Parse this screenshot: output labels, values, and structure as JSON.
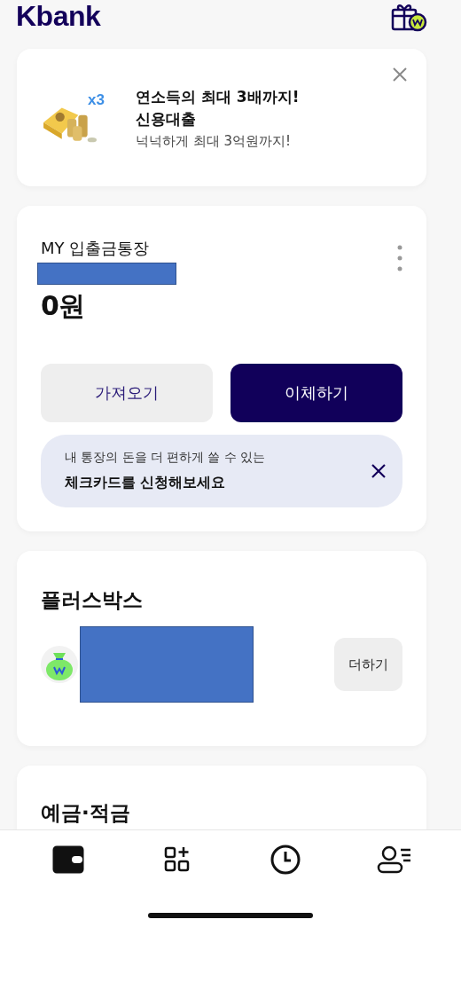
{
  "header": {
    "logo": "Kbank"
  },
  "promo": {
    "badge": "x3",
    "title_lines": [
      "연소득의 최대 3배까지!",
      "신용대출"
    ],
    "subtitle": "넉넉하게 최대 3억원까지!"
  },
  "account": {
    "name": "MY 입출금통장",
    "balance": "0원",
    "buttons": [
      {
        "label": "가져오기",
        "kind": "secondary"
      },
      {
        "label": "이체하기",
        "kind": "primary"
      }
    ],
    "notice": {
      "line1": "내 통장의 돈을 더 편하게 쓸 수 있는",
      "line2": "체크카드를 신청해보세요"
    }
  },
  "plusbox": {
    "title": "플러스박스",
    "button": "더하기"
  },
  "savings": {
    "title": "예금·적금"
  },
  "nav": [
    {
      "kind": "wallet",
      "selected": true
    },
    {
      "kind": "products",
      "selected": false
    },
    {
      "kind": "history",
      "selected": false
    },
    {
      "kind": "profile",
      "selected": false
    }
  ]
}
